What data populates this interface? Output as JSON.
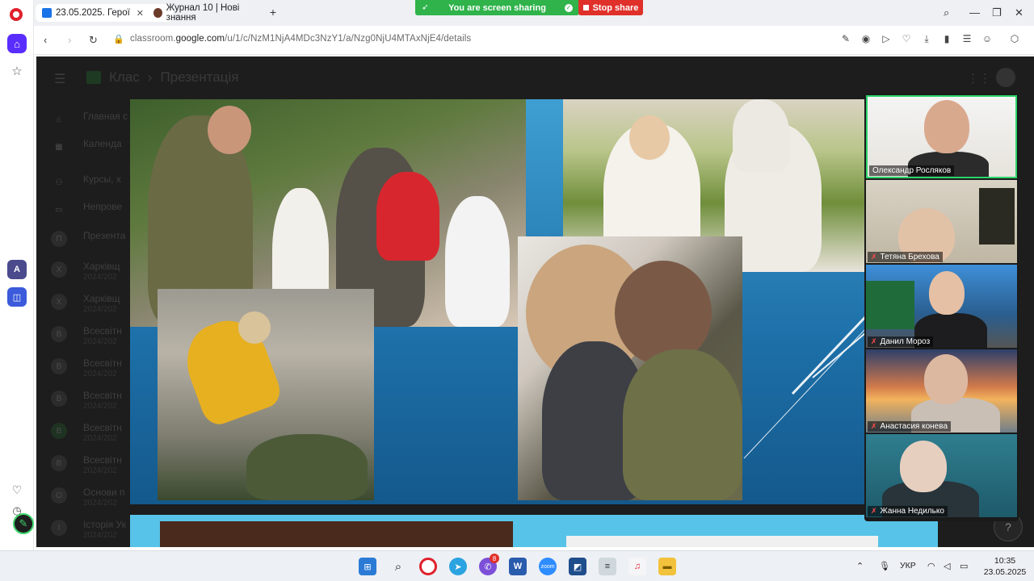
{
  "browser": {
    "tabs": [
      {
        "title": "23.05.2025. Герої"
      },
      {
        "title": "Журнал 10 | Нові знання"
      }
    ],
    "share_banner": "You are screen sharing",
    "stop_share": "Stop share",
    "url_prefix": "classroom.",
    "url_domain": "google.com",
    "url_path": "/u/1/c/NzM1NjA4MDc3NzY1/a/Nzg0NjU4MTAxNjE4/details"
  },
  "classroom": {
    "crumb_class": "Клас",
    "crumb_page": "Презентація",
    "nav": [
      {
        "label": "Главная с",
        "sub": ""
      },
      {
        "label": "Календа",
        "sub": ""
      },
      {
        "label": "Курсы, х",
        "sub": ""
      },
      {
        "label": "Непрове",
        "sub": ""
      },
      {
        "label": "Презента",
        "sub": ""
      },
      {
        "label": "Харківщ",
        "sub": "2024/202"
      },
      {
        "label": "Харківщ",
        "sub": "2024/202"
      },
      {
        "label": "Всесвітн",
        "sub": "2024/202"
      },
      {
        "label": "Всесвітн",
        "sub": "2024/202"
      },
      {
        "label": "Всесвітн",
        "sub": "2024/202"
      },
      {
        "label": "Всесвітн",
        "sub": "2024/202"
      },
      {
        "label": "Всесвітн",
        "sub": "2024/202"
      },
      {
        "label": "Основи п",
        "sub": "2024/202"
      },
      {
        "label": "Історія Ук",
        "sub": "2024/202"
      }
    ]
  },
  "participants": [
    {
      "name": "Олександр Росляков",
      "muted": false
    },
    {
      "name": "Тетяна Брехова",
      "muted": true
    },
    {
      "name": "Данил Мороз",
      "muted": true
    },
    {
      "name": "Анастасия конева",
      "muted": true
    },
    {
      "name": "Жанна Недилько",
      "muted": true
    }
  ],
  "taskbar": {
    "telegram_badge": "8",
    "language": "УКР",
    "time": "10:35",
    "date": "23.05.2025"
  },
  "colors": {
    "accent_opera": "#e0202b",
    "share_green": "#2fb34a",
    "stop_red": "#e0302a",
    "active_speaker": "#2bd46b"
  }
}
